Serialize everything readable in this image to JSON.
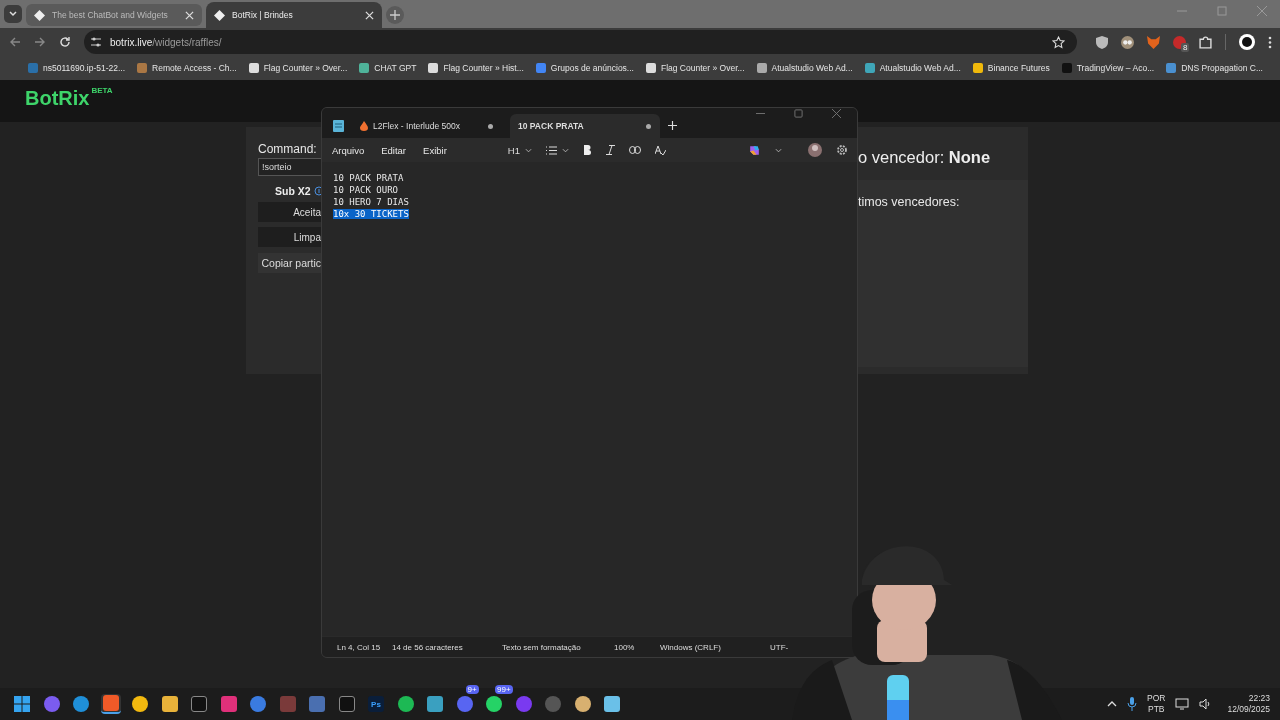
{
  "browser": {
    "tabs": [
      {
        "title": "The best ChatBot and Widgets",
        "selected": false
      },
      {
        "title": "BotRix | Brindes",
        "selected": true
      }
    ],
    "address": {
      "host": "botrix.live",
      "path": "/widgets/raffles/"
    },
    "extension_badge": "8",
    "bookmarks": [
      {
        "label": "ns5011690.ip-51-22..."
      },
      {
        "label": "Remote Access - Ch..."
      },
      {
        "label": "Flag Counter » Over..."
      },
      {
        "label": "CHAT GPT"
      },
      {
        "label": "Flag Counter » Hist..."
      },
      {
        "label": "Grupos de anúncios..."
      },
      {
        "label": "Flag Counter » Over..."
      },
      {
        "label": "Atualstudio Web Ad..."
      },
      {
        "label": "Atualstudio Web Ad..."
      },
      {
        "label": "Binance Futures"
      },
      {
        "label": "TradingView – Aco..."
      },
      {
        "label": "DNS Propagation C..."
      }
    ]
  },
  "page": {
    "logo": "BotRix",
    "logo_badge": "BETA",
    "command_label": "Command:",
    "command_value": "!sorteio",
    "sub_label": "Sub X2",
    "buttons": [
      {
        "label": "Aceita",
        "kind": "dark"
      },
      {
        "label": "Limpa",
        "kind": "dark"
      },
      {
        "label": "Copiar partic",
        "kind": "light"
      }
    ],
    "winner": "o vencedor: **None**",
    "last_winners_label": "timos vencedores:"
  },
  "notepad": {
    "tabs": [
      {
        "title": "L2Flex - Interlude 500x",
        "selected": false,
        "modified": true
      },
      {
        "title": "10 PACK PRATA",
        "selected": true,
        "modified": true
      }
    ],
    "menus": [
      "Arquivo",
      "Editar",
      "Exibir"
    ],
    "heading_button": "H1",
    "lines": [
      {
        "text": "10 PACK PRATA",
        "selected": false
      },
      {
        "text": "10 PACK OURO",
        "selected": false
      },
      {
        "text": "10 HERO 7 DIAS",
        "selected": false
      },
      {
        "text": "10x 30 TICKETS",
        "selected": true
      }
    ],
    "status": [
      "Ln 4, Col 15",
      "14 de 56 caracteres",
      "Texto sem formatação",
      "100%",
      "Windows (CRLF)",
      "UTF-"
    ]
  },
  "taskbar": {
    "apps": [
      {
        "active": false
      },
      {
        "active": false
      },
      {
        "active": false
      },
      {
        "active": true
      },
      {
        "active": false
      },
      {
        "active": false
      },
      {
        "active": false
      },
      {
        "active": false
      },
      {
        "active": false
      },
      {
        "active": false
      },
      {
        "active": false
      },
      {
        "active": false
      },
      {
        "active": false,
        "label": "Ps"
      },
      {
        "active": false
      },
      {
        "active": false
      },
      {
        "active": false,
        "badge": "9+"
      },
      {
        "active": false,
        "badge": "99+"
      },
      {
        "active": false
      },
      {
        "active": false
      },
      {
        "active": false
      },
      {
        "active": false
      }
    ],
    "language": "POR",
    "layout": "PTB",
    "time": "22:23",
    "date": "12/09/2025"
  }
}
